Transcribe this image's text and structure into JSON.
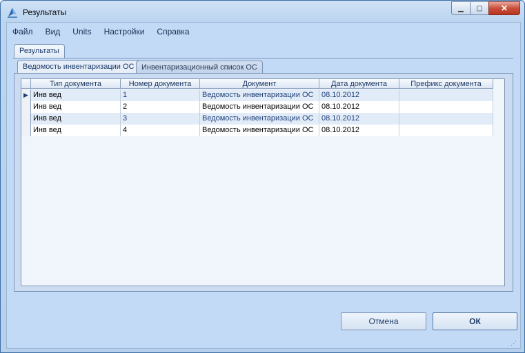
{
  "window": {
    "title": "Результаты"
  },
  "menu": [
    "Файл",
    "Вид",
    "Units",
    "Настройки",
    "Справка"
  ],
  "outer_tab": "Результаты",
  "inner_tabs": [
    "Ведомость инвентаризации ОС",
    "Инвентаризационный список ОС"
  ],
  "grid": {
    "columns": [
      "Тип документа",
      "Номер документа",
      "Документ",
      "Дата документа",
      "Префикс документа"
    ],
    "rows": [
      {
        "type": "Инв вед",
        "number": "1",
        "document": "Ведомость инвентаризации ОС",
        "date": "08.10.2012",
        "prefix": ""
      },
      {
        "type": "Инв вед",
        "number": "2",
        "document": "Ведомость инвентаризации ОС",
        "date": "08.10.2012",
        "prefix": ""
      },
      {
        "type": "Инв вед",
        "number": "3",
        "document": "Ведомость инвентаризации ОС",
        "date": "08.10.2012",
        "prefix": ""
      },
      {
        "type": "Инв вед",
        "number": "4",
        "document": "Ведомость инвентаризации ОС",
        "date": "08.10.2012",
        "prefix": ""
      }
    ],
    "selected_row_indicator": "▶"
  },
  "buttons": {
    "cancel": "Отмена",
    "ok": "ОК"
  },
  "icons": {
    "app": "app-logo-icon",
    "minimize": "minimize-icon",
    "maximize": "maximize-icon",
    "close": "close-icon",
    "grip": "resize-grip-icon"
  },
  "colors": {
    "accent": "#1d3f78",
    "close": "#c9503b"
  }
}
